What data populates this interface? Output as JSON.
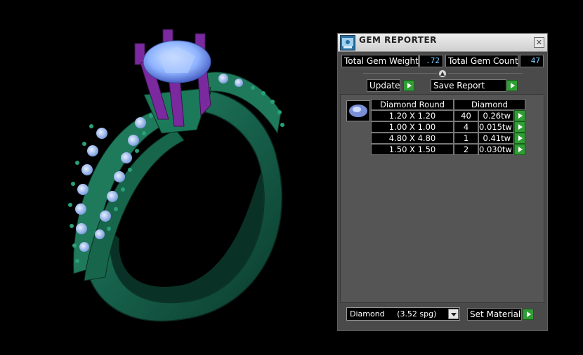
{
  "panel": {
    "title": "GEM REPORTER",
    "close_glyph": "✕",
    "total_gem_weight_label": "Total Gem Weight",
    "total_gem_weight_value": ".72",
    "total_gem_count_label": "Total Gem Count",
    "total_gem_count_value": "47",
    "update_label": "Update",
    "save_report_label": "Save Report",
    "set_material_label": "Set Material",
    "material_value": "Diamond     (3.52 spg)"
  },
  "table": {
    "header_shape": "Diamond Round",
    "header_material": "Diamond",
    "rows": [
      {
        "size": "1.20 X 1.20",
        "count": "40",
        "weight": "0.26tw"
      },
      {
        "size": "1.00 X 1.00",
        "count": "4",
        "weight": "0.015tw"
      },
      {
        "size": "4.80 X 4.80",
        "count": "1",
        "weight": "0.41tw"
      },
      {
        "size": "1.50 X 1.50",
        "count": "2",
        "weight": "0.030tw"
      }
    ]
  },
  "colors": {
    "ring_metal": "#1c6e55",
    "prongs": "#7a2a9e",
    "gem": "#8fb4ff",
    "go_button": "#2f9e34"
  },
  "icons": [
    "app-icon",
    "close-icon",
    "gem-thumbnail-icon",
    "go-arrow-icon",
    "dropdown-arrow-icon"
  ]
}
